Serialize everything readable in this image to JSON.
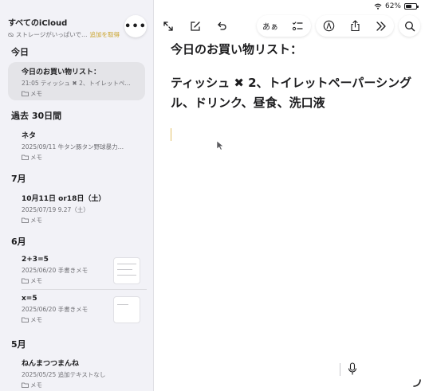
{
  "status": {
    "wifi_icon": "wifi-icon",
    "battery_text": "62%",
    "battery_level": 0.62
  },
  "sidebar": {
    "title": "すべてのiCloud",
    "storage_warning": "ストレージがいっぱいで…",
    "storage_link": "追加を取得",
    "more_icon": "ellipsis-icon",
    "more_label": "•••",
    "sections": [
      {
        "label": "今日",
        "notes": [
          {
            "title": "今日のお買い物リスト：",
            "meta": "21:05  ティッシュ ✖︎ 2、トイレットペ…",
            "folder": "メモ",
            "selected": true
          }
        ]
      },
      {
        "label": "過去 30日間",
        "notes": [
          {
            "title": "ネタ",
            "meta": "2025/09/11  牛タン豚タン野球暴力…",
            "folder": "メモ"
          }
        ]
      },
      {
        "label": "7月",
        "notes": [
          {
            "title": "10月11日 or18日（土）",
            "meta": "2025/07/19  9.27（土）",
            "folder": "メモ"
          }
        ]
      },
      {
        "label": "6月",
        "notes": [
          {
            "title": "2+3=5",
            "meta": "2025/06/20  手書きメモ",
            "folder": "メモ"
          },
          {
            "title": "x=5",
            "meta": "2025/06/20  手書きメモ",
            "folder": "メモ"
          }
        ]
      },
      {
        "label": "5月",
        "notes": [
          {
            "title": "ねんまつつまんね",
            "meta": "2025/05/25  追加テキストなし",
            "folder": "メモ"
          }
        ]
      }
    ]
  },
  "toolbar": {
    "format_label": "あぁ",
    "icons": [
      "expand-icon",
      "compose-icon",
      "undo-icon",
      "format-text-icon",
      "checklist-icon",
      "markup-icon",
      "share-icon",
      "more-forward-icon",
      "search-icon"
    ]
  },
  "note": {
    "line1": "今日のお買い物リスト：",
    "line2": "ティッシュ ✖︎ 2、トイレットペーパーシングル、ドリンク、昼食、洗口液"
  },
  "colors": {
    "accent": "#e3c26a",
    "sidebar_bg": "#f2f2f7",
    "selected_bg": "#e4e4e8"
  }
}
